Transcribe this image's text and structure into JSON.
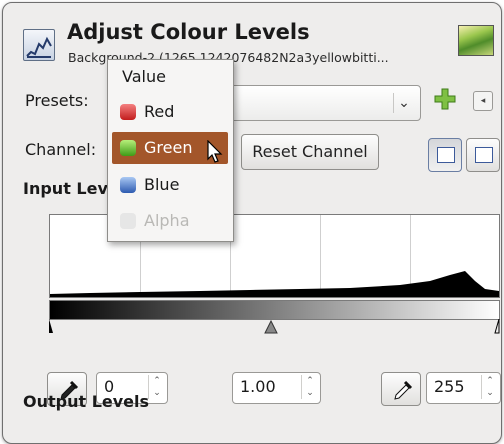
{
  "dialog": {
    "title": "Adjust Colour Levels",
    "subtitle": "Background-2 (1265 1242076482N2a3yellowbitti..."
  },
  "presets": {
    "label": "Presets:",
    "value": ""
  },
  "channel": {
    "label": "Channel:",
    "reset_label": "Reset Channel"
  },
  "channel_menu": {
    "items": [
      {
        "label": "Value",
        "icon": "none",
        "state": "normal"
      },
      {
        "label": "Red",
        "icon": "red-channel-icon",
        "state": "normal"
      },
      {
        "label": "Green",
        "icon": "green-channel-icon",
        "state": "selected"
      },
      {
        "label": "Blue",
        "icon": "blue-channel-icon",
        "state": "normal"
      },
      {
        "label": "Alpha",
        "icon": "alpha-channel-icon",
        "state": "disabled"
      }
    ]
  },
  "input_levels": {
    "title": "Input Levels",
    "low": "0",
    "gamma": "1.00",
    "high": "255"
  },
  "output_levels": {
    "title": "Output Levels"
  },
  "colors": {
    "selection": "#a3562a",
    "panel_bg": "#eeedec",
    "add_preset": "#5fa82d"
  }
}
